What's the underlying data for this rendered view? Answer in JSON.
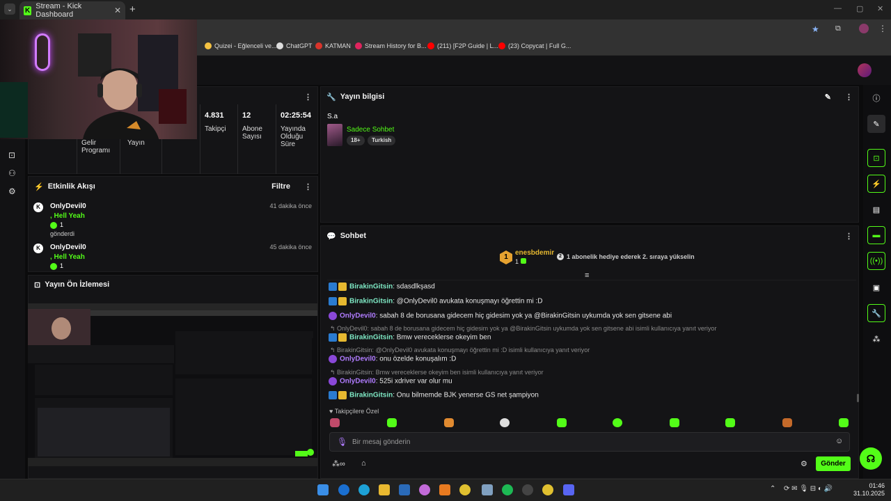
{
  "browser": {
    "tab_title": "Stream - Kick Dashboard",
    "tab_close": "✕",
    "new_tab": "+",
    "bookmarks": [
      {
        "label": "Quizei - Eğlenceli ve...",
        "color": "#f5c242"
      },
      {
        "label": "ChatGPT",
        "color": "#dddddd"
      },
      {
        "label": "KATMAN",
        "color": "#d9342b"
      },
      {
        "label": "Stream History for B...",
        "color": "#e0245e"
      },
      {
        "label": "(211) [F2P Guide | L...",
        "color": "#ff0000"
      },
      {
        "label": "(23) Copycat | Full G...",
        "color": "#ff0000"
      }
    ]
  },
  "stats": [
    {
      "value": "",
      "label": "Gelir Programı"
    },
    {
      "value": "",
      "label": "Yayın"
    },
    {
      "value": "",
      "label": ""
    },
    {
      "value": "4.831",
      "label": "Takipçi"
    },
    {
      "value": "12",
      "label": "Abone Sayısı"
    },
    {
      "value": "02:25:54",
      "label": "Yayında Olduğu Süre"
    }
  ],
  "activity": {
    "title": "Etkinlik Akışı",
    "filter_label": "Filtre",
    "items": [
      {
        "user": "OnlyDevil0",
        "time": "41 dakika önce",
        "message": ", Hell Yeah",
        "count": "1",
        "sent": "gönderdi"
      },
      {
        "user": "OnlyDevil0",
        "time": "45 dakika önce",
        "message": ", Hell Yeah",
        "count": "1",
        "sent": ""
      }
    ]
  },
  "preview": {
    "title": "Yayın Ön İzlemesi"
  },
  "stream_info": {
    "title": "Yayın bilgisi",
    "stream_title": "S.a",
    "category": "Sadece Sohbet",
    "tags": [
      "18+",
      "Turkish"
    ]
  },
  "chat": {
    "title": "Sohbet",
    "gift_user": "enesbdemir",
    "gift_count": "1",
    "gift_rank": "1",
    "gift_text": "1 abonelik hediye ederek 2. sıraya yükselin",
    "messages": [
      {
        "type": "msg",
        "user": "BirakinGitsin",
        "badges": "blue-crown",
        "text": ": sdasdlkşasd"
      },
      {
        "type": "msg",
        "user": "BirakinGitsin",
        "badges": "blue-crown",
        "text": ": @OnlyDevil0 avukata konuşmayı öğrettin mi :D"
      },
      {
        "type": "msg",
        "user": "OnlyDevil0",
        "badges": "purple",
        "text": ": sabah 8 de borusana gidecem hiç gidesim yok ya @BirakinGitsin uykumda yok sen gitsene abi"
      },
      {
        "type": "reply",
        "text": "OnlyDevil0: sabah 8 de borusana gidecem hiç gidesim yok ya @BirakinGitsin uykumda yok sen gitsene abi isimli kullanıcıya yanıt veriyor"
      },
      {
        "type": "msg",
        "user": "BirakinGitsin",
        "badges": "blue-crown",
        "text": ": Bmw vereceklerse okeyim ben"
      },
      {
        "type": "reply",
        "text": "BirakinGitsin: @OnlyDevil0 avukata konuşmayı öğrettin mi :D isimli kullanıcıya yanıt veriyor"
      },
      {
        "type": "msg",
        "user": "OnlyDevil0",
        "badges": "purple",
        "text": ": onu özelde konuşalım :D"
      },
      {
        "type": "reply",
        "text": "BirakinGitsin: Bmw vereceklerse okeyim ben isimli kullanıcıya yanıt veriyor"
      },
      {
        "type": "msg",
        "user": "OnlyDevil0",
        "badges": "purple",
        "text": ": 525i xdriver var olur mu"
      },
      {
        "type": "msg",
        "user": "BirakinGitsin",
        "badges": "blue-crown",
        "text": ": Onu bilmemde BJK yenerse GS net şampiyon"
      }
    ],
    "followers_only": "Takipçilere Özel",
    "input_placeholder": "Bir mesaj gönderin",
    "send_label": "Gönder"
  },
  "taskbar": {
    "time": "01:46",
    "date": "31.10.2025"
  },
  "colors": {
    "accent": "#53fc18",
    "panel": "#141416",
    "background": "#0b0b0c"
  }
}
